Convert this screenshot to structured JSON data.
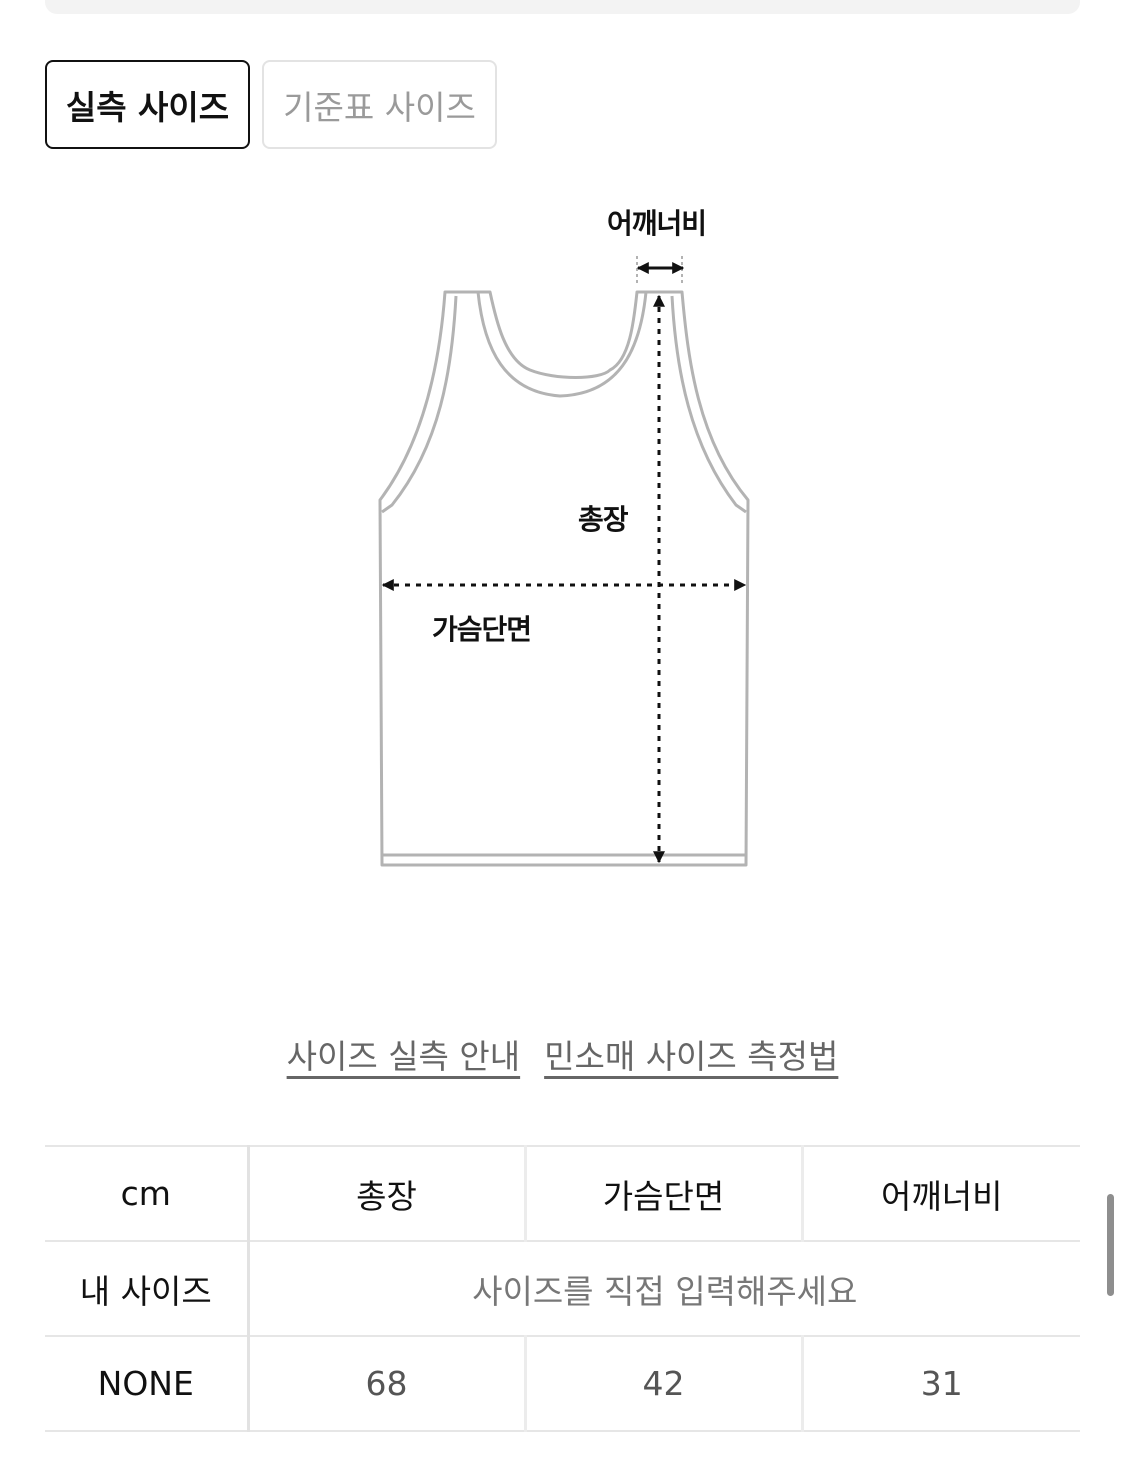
{
  "tabs": {
    "active_label": "실측 사이즈",
    "inactive_label": "기준표 사이즈"
  },
  "diagram": {
    "shoulder_label": "어깨너비",
    "length_label": "총장",
    "chest_label": "가슴단면"
  },
  "guide_links": [
    "사이즈 실측 안내",
    "민소매 사이즈 측정법"
  ],
  "table": {
    "unit": "cm",
    "headers": [
      "총장",
      "가슴단면",
      "어깨너비"
    ],
    "my_size_label": "내 사이즈",
    "my_size_placeholder": "사이즈를 직접 입력해주세요",
    "rows": [
      {
        "size": "NONE",
        "values": [
          "68",
          "42",
          "31"
        ]
      }
    ]
  }
}
